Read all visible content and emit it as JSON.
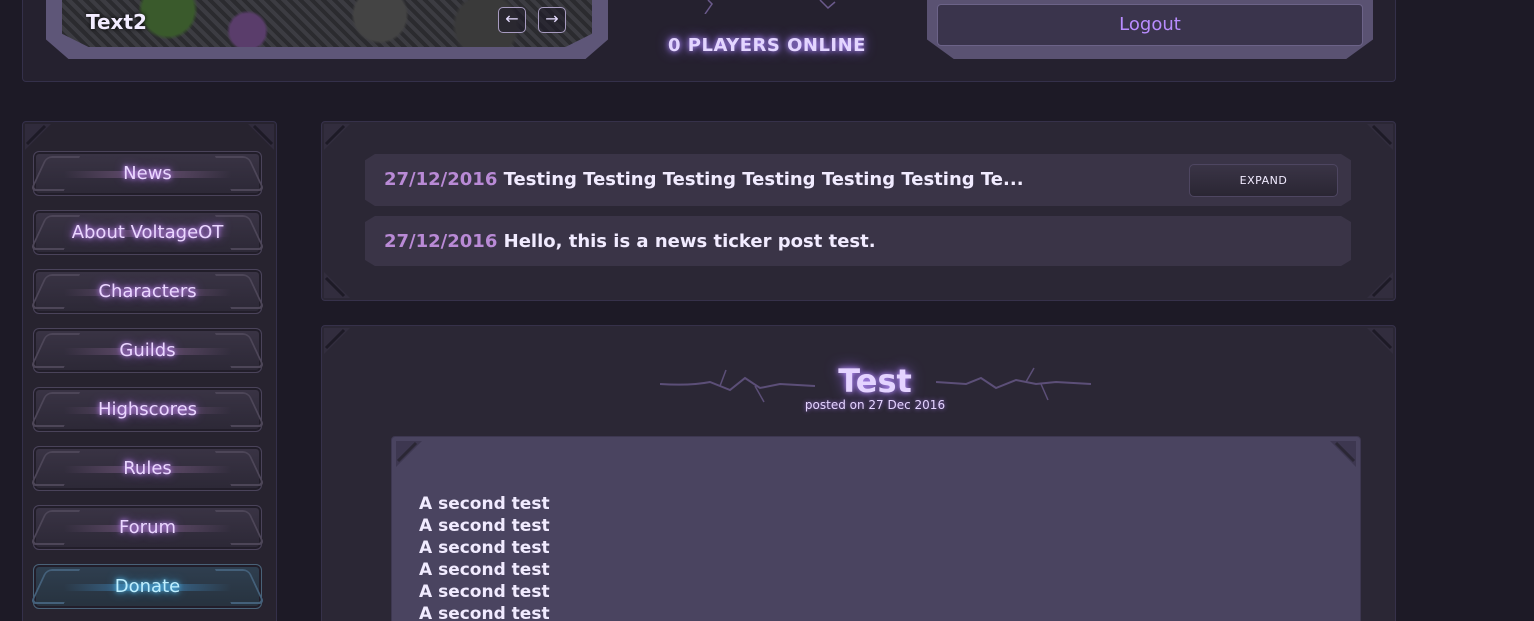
{
  "header": {
    "slider_title": "Text2",
    "prev_arrow": "←",
    "next_arrow": "→",
    "online_count": "0 PLAYERS ONLINE",
    "logout_label": "Logout"
  },
  "sidebar": {
    "items": [
      {
        "label": "News"
      },
      {
        "label": "About VoltageOT"
      },
      {
        "label": "Characters"
      },
      {
        "label": "Guilds"
      },
      {
        "label": "Highscores"
      },
      {
        "label": "Rules"
      },
      {
        "label": "Forum"
      },
      {
        "label": "Donate"
      }
    ]
  },
  "ticker": {
    "expand_label": "EXPAND",
    "entries": [
      {
        "date": "27/12/2016",
        "text": "Testing Testing Testing Testing Testing Testing Te..."
      },
      {
        "date": "27/12/2016",
        "text": "Hello, this is a news ticker post test."
      }
    ]
  },
  "article": {
    "title": "Test",
    "meta": "posted on 27 Dec 2016",
    "lines": [
      "A second test",
      "A second test",
      "A second test",
      "A second test",
      "A second test",
      "A second test"
    ]
  },
  "colors": {
    "background": "#1d1a26",
    "panel": "#2b2735",
    "accent_purple": "#b98cff",
    "accent_blue": "#5ccfff",
    "ticker_date": "#b98ad6"
  }
}
